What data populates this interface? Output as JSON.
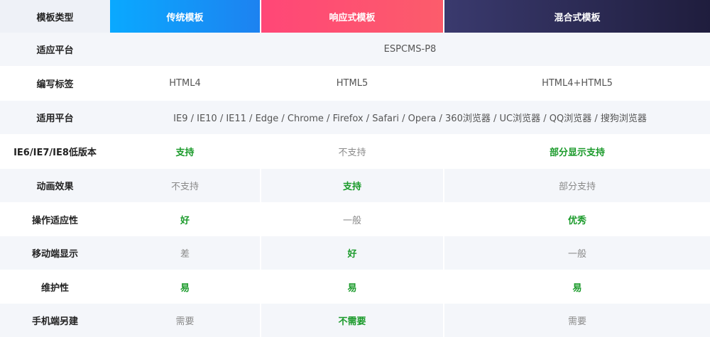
{
  "header": {
    "label": "模板类型",
    "col1": "传统模板",
    "col2": "响应式模板",
    "col3": "混合式模板"
  },
  "rows": [
    {
      "label": "适应平台",
      "span": "ESPCMS-P8"
    },
    {
      "label": "编写标签",
      "col1": "HTML4",
      "col2": "HTML5",
      "col3": "HTML4+HTML5"
    },
    {
      "label": "适用平台",
      "span": "IE9 / IE10 / IE11 / Edge / Chrome / Firefox / Safari / Opera / 360浏览器 / UC浏览器 / QQ浏览器 / 搜狗浏览器"
    },
    {
      "label": "IE6/IE7/IE8低版本",
      "col1": "支持",
      "col2": "不支持",
      "col3": "部分显示支持"
    },
    {
      "label": "动画效果",
      "col1": "不支持",
      "col2": "支持",
      "col3": "部分支持"
    },
    {
      "label": "操作适应性",
      "col1": "好",
      "col2": "一般",
      "col3": "优秀"
    },
    {
      "label": "移动端显示",
      "col1": "差",
      "col2": "好",
      "col3": "一般"
    },
    {
      "label": "维护性",
      "col1": "易",
      "col2": "易",
      "col3": "易"
    },
    {
      "label": "手机端另建",
      "col1": "需要",
      "col2": "不需要",
      "col3": "需要"
    }
  ],
  "colors": {
    "good": "#1a9a2a",
    "muted": "#8a8a8a",
    "traditional": "#1d82f0",
    "responsive": "#ff4777",
    "hybrid": "#2b2a52"
  }
}
